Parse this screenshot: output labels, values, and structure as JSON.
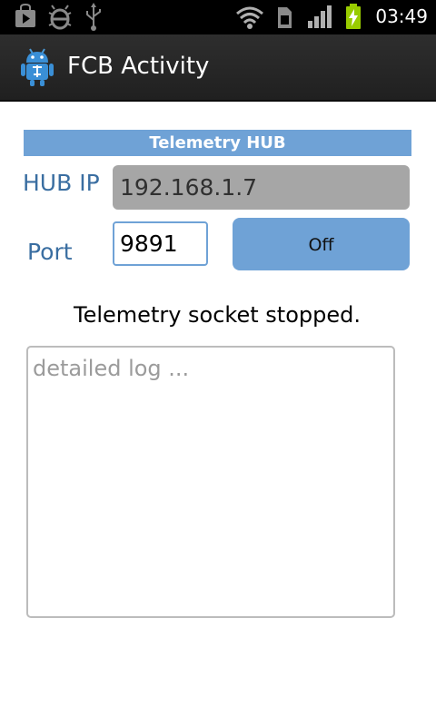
{
  "status_bar": {
    "time": "03:49",
    "icons": [
      "play-store-notification-icon",
      "debug-bug-icon",
      "usb-icon",
      "wifi-icon",
      "sim-card-icon",
      "signal-bars-icon",
      "battery-charging-icon"
    ]
  },
  "app_bar": {
    "title": "FCB Activity",
    "icon": "android-app-icon"
  },
  "telemetry": {
    "section_title": "Telemetry HUB",
    "hub_ip_label": "HUB IP",
    "hub_ip_value": "192.168.1.7",
    "port_label": "Port",
    "port_value": "9891",
    "toggle_label": "Off",
    "status_message": "Telemetry socket stopped.",
    "log_placeholder": "detailed log ..."
  },
  "colors": {
    "accent": "#6fa2d6",
    "label_text": "#3a6ea1",
    "disabled_field": "#a6a6a6",
    "battery": "#99cc00"
  }
}
